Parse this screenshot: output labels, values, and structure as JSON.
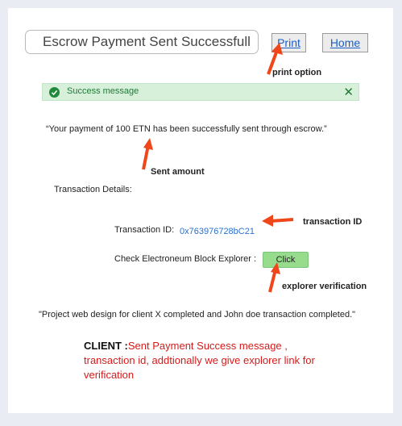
{
  "header": {
    "title_value": "Escrow Payment Sent Successfull",
    "print_label": "Print",
    "home_label": "Home"
  },
  "alert": {
    "message": "Success message",
    "close_glyph": "✕",
    "check_icon": "check-circle-icon"
  },
  "main": {
    "payment_message": "“Your payment of 100 ETN has been successfully sent through escrow.”",
    "details_heading": "Transaction Details:",
    "transaction_id_label": "Transaction ID:",
    "transaction_id_value": "0x763976728bC21",
    "explorer_label": "Check Electroneum Block Explorer :",
    "click_label": "Click",
    "project_message": "\"Project web design for client  X completed and John doe transaction completed.\""
  },
  "annotations": {
    "print_option": "print option",
    "sent_amount": "Sent amount",
    "transaction_id": "transaction ID",
    "explorer_verification": "explorer verification",
    "arrow_color": "#f0471a"
  },
  "client_note": {
    "label": "CLIENT :",
    "text": "Sent Payment Success message , transaction id, addtionally we give explorer link for verification"
  },
  "colors": {
    "page_bg": "#e9edf3",
    "alert_bg": "#d6f0da",
    "alert_text": "#1f7a36",
    "link": "#1a5fc8",
    "click_button": "#96dc8c",
    "client_note": "#d61a1a"
  }
}
